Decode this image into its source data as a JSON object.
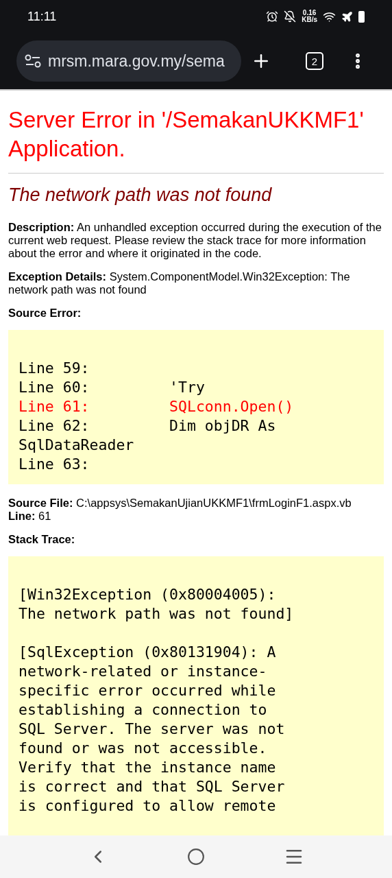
{
  "status_bar": {
    "time": "11:11",
    "speed_value": "0.16",
    "speed_unit": "KB/s"
  },
  "browser_toolbar": {
    "url": "mrsm.mara.gov.my/sema",
    "tab_count": "2"
  },
  "page": {
    "title": "Server Error in '/SemakanUKKMF1' Application.",
    "subtitle": "The network path was not found",
    "description": {
      "label": "Description:",
      "text": "An unhandled exception occurred during the execution of the current web request. Please review the stack trace for more information about the error and where it originated in the code."
    },
    "exception_details": {
      "label": "Exception Details:",
      "text": "System.ComponentModel.Win32Exception: The network path was not found"
    },
    "source_error_label": "Source Error:",
    "source_lines": [
      {
        "text": "Line 59:",
        "highlighted": false
      },
      {
        "text": "Line 60:         'Try",
        "highlighted": false
      },
      {
        "text": "Line 61:         SQLconn.Open()",
        "highlighted": true
      },
      {
        "text": "Line 62:         Dim objDR As SqlDataReader",
        "highlighted": false
      },
      {
        "text": "Line 63:",
        "highlighted": false
      }
    ],
    "source_file": {
      "label": "Source File:",
      "text": "C:\\appsys\\SemakanUjianUKKMF1\\frmLoginF1.aspx.vb"
    },
    "line": {
      "label": "Line:",
      "text": "61"
    },
    "stack_trace_label": "Stack Trace:",
    "stack_trace": [
      "[Win32Exception (0x80004005): The network path was not found]",
      "[SqlException (0x80131904): A network-related or instance-specific error occurred while establishing a connection to SQL Server. The server was not found or was not accessible. Verify that the instance name is correct and that SQL Server is configured to allow remote"
    ]
  }
}
